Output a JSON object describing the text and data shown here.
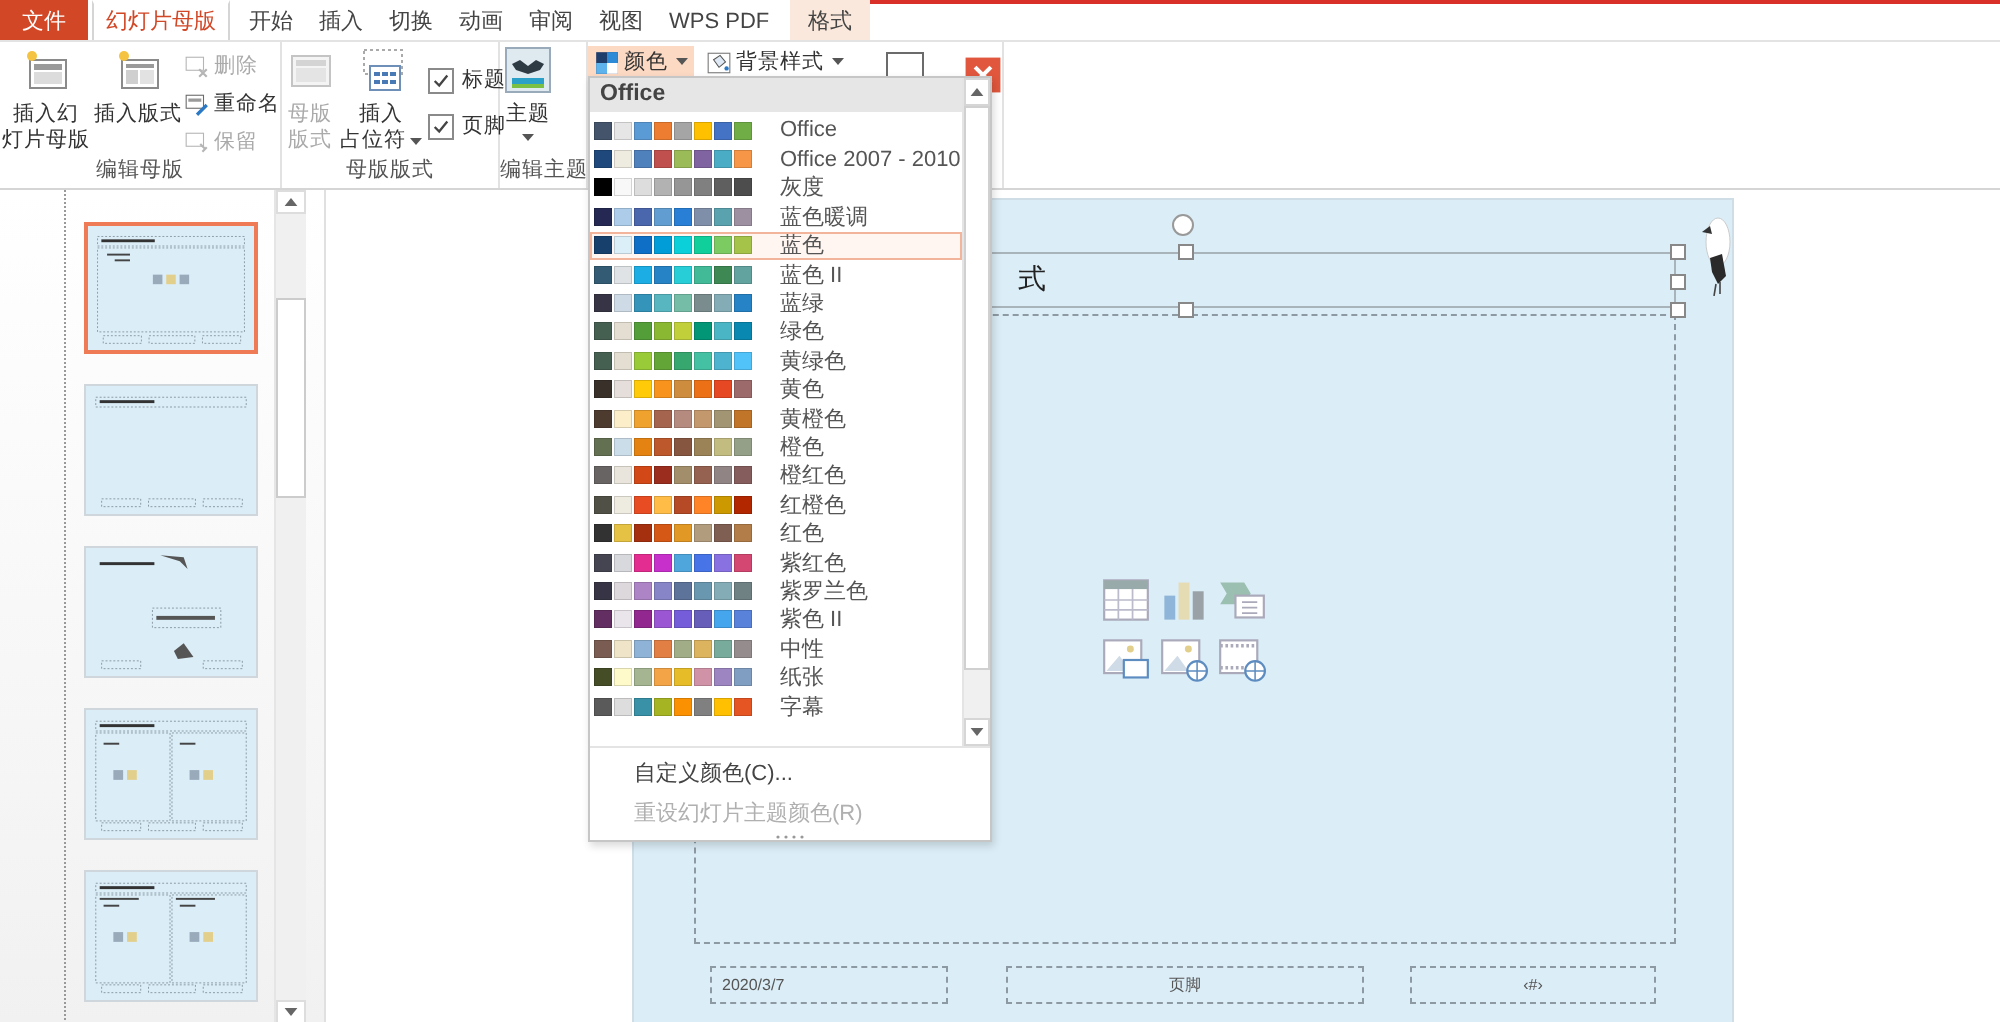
{
  "tabs": [
    {
      "label": "文件",
      "kind": "file",
      "selected": false
    },
    {
      "label": "幻灯片母版",
      "kind": "normal",
      "selected": true
    },
    {
      "label": "开始",
      "kind": "normal",
      "selected": false
    },
    {
      "label": "插入",
      "kind": "normal",
      "selected": false
    },
    {
      "label": "切换",
      "kind": "normal",
      "selected": false
    },
    {
      "label": "动画",
      "kind": "normal",
      "selected": false
    },
    {
      "label": "审阅",
      "kind": "normal",
      "selected": false
    },
    {
      "label": "视图",
      "kind": "normal",
      "selected": false
    },
    {
      "label": "WPS PDF",
      "kind": "normal",
      "selected": false
    },
    {
      "label": "格式",
      "kind": "contextual",
      "selected": false
    }
  ],
  "ribbon": {
    "groups": [
      {
        "label": "编辑母版",
        "controls": [
          {
            "kind": "large",
            "lines": [
              "插入幻",
              "灯片母版"
            ],
            "disabled": false,
            "dropdown": false
          },
          {
            "kind": "large",
            "lines": [
              "插入版式"
            ],
            "disabled": false,
            "dropdown": false
          },
          {
            "kind": "small",
            "label": "删除",
            "disabled": true
          },
          {
            "kind": "small",
            "label": "重命名",
            "disabled": false
          },
          {
            "kind": "small",
            "label": "保留",
            "disabled": true
          }
        ]
      },
      {
        "label": "母版版式",
        "controls": [
          {
            "kind": "large",
            "lines": [
              "母版",
              "版式"
            ],
            "disabled": true,
            "dropdown": false
          },
          {
            "kind": "large",
            "lines": [
              "插入",
              "占位符"
            ],
            "disabled": false,
            "dropdown": true
          },
          {
            "kind": "check",
            "label": "标题",
            "checked": true
          },
          {
            "kind": "check",
            "label": "页脚",
            "checked": true
          }
        ]
      },
      {
        "label": "编辑主题",
        "controls": [
          {
            "kind": "large",
            "lines": [
              "主题"
            ],
            "disabled": false,
            "dropdown": true
          }
        ]
      },
      {
        "controls": [
          {
            "kind": "menu",
            "label": "颜色",
            "active": true,
            "dropdown": true
          },
          {
            "kind": "menu",
            "label": "背景样式",
            "active": false,
            "dropdown": true
          },
          {
            "kind": "icon"
          },
          {
            "kind": "close"
          }
        ]
      }
    ]
  },
  "thumbnails": [
    {
      "kind": "title-content",
      "selected": true
    },
    {
      "kind": "title-only",
      "selected": false
    },
    {
      "kind": "section",
      "selected": false
    },
    {
      "kind": "two-content",
      "selected": false
    },
    {
      "kind": "comparison",
      "selected": false
    }
  ],
  "slide": {
    "title": "式",
    "footer_date": "2020/3/7",
    "footer_text": "页脚",
    "footer_number": "‹#›"
  },
  "color_menu": {
    "header": "Office",
    "schemes": [
      {
        "name": "Office",
        "selected": false,
        "swatches": [
          {
            "color": "#44546a"
          },
          {
            "color": "#e7e6e6"
          },
          {
            "color": "#5b9bd5"
          },
          {
            "color": "#ed7d31"
          },
          {
            "color": "#a5a5a5"
          },
          {
            "color": "#ffc000"
          },
          {
            "color": "#4472c4"
          },
          {
            "color": "#70ad47"
          }
        ]
      },
      {
        "name": "Office 2007 - 2010",
        "selected": false,
        "swatches": [
          {
            "color": "#1f497d"
          },
          {
            "color": "#eeece1"
          },
          {
            "color": "#4f81bd"
          },
          {
            "color": "#c0504d"
          },
          {
            "color": "#9bbb59"
          },
          {
            "color": "#8064a2"
          },
          {
            "color": "#4bacc6"
          },
          {
            "color": "#f79646"
          }
        ]
      },
      {
        "name": "灰度",
        "selected": false,
        "swatches": [
          {
            "color": "#000000"
          },
          {
            "color": "#f8f8f8"
          },
          {
            "color": "#dddddd"
          },
          {
            "color": "#b2b2b2"
          },
          {
            "color": "#969696"
          },
          {
            "color": "#808080"
          },
          {
            "color": "#5f5f5f"
          },
          {
            "color": "#4d4d4d"
          }
        ]
      },
      {
        "name": "蓝色暖调",
        "selected": false,
        "swatches": [
          {
            "color": "#242852"
          },
          {
            "color": "#acccea"
          },
          {
            "color": "#4a66ac"
          },
          {
            "color": "#629dd1"
          },
          {
            "color": "#297fd5"
          },
          {
            "color": "#7f8fa9"
          },
          {
            "color": "#5aa2ae"
          },
          {
            "color": "#9d90a0"
          }
        ]
      },
      {
        "name": "蓝色",
        "selected": true,
        "swatches": [
          {
            "color": "#17406d"
          },
          {
            "color": "#dbeff9"
          },
          {
            "color": "#0f6fc6"
          },
          {
            "color": "#009dd9"
          },
          {
            "color": "#0bd0d9"
          },
          {
            "color": "#10cf9b"
          },
          {
            "color": "#7cca62"
          },
          {
            "color": "#a5c249"
          }
        ]
      },
      {
        "name": "蓝色 II",
        "selected": false,
        "swatches": [
          {
            "color": "#335b74"
          },
          {
            "color": "#dfe3e5"
          },
          {
            "color": "#1cade4"
          },
          {
            "color": "#2683c6"
          },
          {
            "color": "#27ced7"
          },
          {
            "color": "#42ba97"
          },
          {
            "color": "#3e8853"
          },
          {
            "color": "#62a39f"
          }
        ]
      },
      {
        "name": "蓝绿",
        "selected": false,
        "swatches": [
          {
            "color": "#373545"
          },
          {
            "color": "#cedbe6"
          },
          {
            "color": "#3494ba"
          },
          {
            "color": "#58b6c0"
          },
          {
            "color": "#75bda7"
          },
          {
            "color": "#7a8c8e"
          },
          {
            "color": "#84acb6"
          },
          {
            "color": "#2683c6"
          }
        ]
      },
      {
        "name": "绿色",
        "selected": false,
        "swatches": [
          {
            "color": "#455f51"
          },
          {
            "color": "#e3ded1"
          },
          {
            "color": "#549e39"
          },
          {
            "color": "#8ab833"
          },
          {
            "color": "#c0cf3a"
          },
          {
            "color": "#029676"
          },
          {
            "color": "#4ab5c4"
          },
          {
            "color": "#0989b1"
          }
        ]
      },
      {
        "name": "黄绿色",
        "selected": false,
        "swatches": [
          {
            "color": "#455f51"
          },
          {
            "color": "#e3ded1"
          },
          {
            "color": "#99cb38"
          },
          {
            "color": "#63a537"
          },
          {
            "color": "#37a76f"
          },
          {
            "color": "#44c1a3"
          },
          {
            "color": "#4eb3cf"
          },
          {
            "color": "#51c3f9"
          }
        ]
      },
      {
        "name": "黄色",
        "selected": false,
        "swatches": [
          {
            "color": "#39302a"
          },
          {
            "color": "#e5dedb"
          },
          {
            "color": "#ffca08"
          },
          {
            "color": "#f8931d"
          },
          {
            "color": "#ce8d3e"
          },
          {
            "color": "#ec7016"
          },
          {
            "color": "#e64823"
          },
          {
            "color": "#9c6a6a"
          }
        ]
      },
      {
        "name": "黄橙色",
        "selected": false,
        "swatches": [
          {
            "color": "#4e3b30"
          },
          {
            "color": "#fbeec9"
          },
          {
            "color": "#f0a22e"
          },
          {
            "color": "#a5644e"
          },
          {
            "color": "#b58b80"
          },
          {
            "color": "#c3986d"
          },
          {
            "color": "#a19574"
          },
          {
            "color": "#c17529"
          }
        ]
      },
      {
        "name": "橙色",
        "selected": false,
        "swatches": [
          {
            "color": "#637052"
          },
          {
            "color": "#ccddea"
          },
          {
            "color": "#e48312"
          },
          {
            "color": "#bd582c"
          },
          {
            "color": "#865640"
          },
          {
            "color": "#9b8357"
          },
          {
            "color": "#c2bc80"
          },
          {
            "color": "#94a088"
          }
        ]
      },
      {
        "name": "橙红色",
        "selected": false,
        "swatches": [
          {
            "color": "#696464"
          },
          {
            "color": "#e9e5dc"
          },
          {
            "color": "#d34817"
          },
          {
            "color": "#9b2d1f"
          },
          {
            "color": "#a28e6a"
          },
          {
            "color": "#956251"
          },
          {
            "color": "#918485"
          },
          {
            "color": "#855d5d"
          }
        ]
      },
      {
        "name": "红橙色",
        "selected": false,
        "swatches": [
          {
            "color": "#505046"
          },
          {
            "color": "#eeece1"
          },
          {
            "color": "#e84c22"
          },
          {
            "color": "#ffbd47"
          },
          {
            "color": "#b64926"
          },
          {
            "color": "#ff8427"
          },
          {
            "color": "#cc9900"
          },
          {
            "color": "#b22600"
          }
        ]
      },
      {
        "name": "红色",
        "selected": false,
        "swatches": [
          {
            "color": "#323232"
          },
          {
            "color": "#e5c243"
          },
          {
            "color": "#a5300f"
          },
          {
            "color": "#d55816"
          },
          {
            "color": "#e19825"
          },
          {
            "color": "#b19c7d"
          },
          {
            "color": "#7f5f52"
          },
          {
            "color": "#b27d49"
          }
        ]
      },
      {
        "name": "紫红色",
        "selected": false,
        "swatches": [
          {
            "color": "#454551"
          },
          {
            "color": "#d8d9dc"
          },
          {
            "color": "#e32d91"
          },
          {
            "color": "#c830cc"
          },
          {
            "color": "#4ea6dc"
          },
          {
            "color": "#4775e7"
          },
          {
            "color": "#8971e1"
          },
          {
            "color": "#d54773"
          }
        ]
      },
      {
        "name": "紫罗兰色",
        "selected": false,
        "swatches": [
          {
            "color": "#373545"
          },
          {
            "color": "#dcd8dc"
          },
          {
            "color": "#ad84c6"
          },
          {
            "color": "#8784c7"
          },
          {
            "color": "#5d739a"
          },
          {
            "color": "#6997af"
          },
          {
            "color": "#84acb6"
          },
          {
            "color": "#6f8183"
          }
        ]
      },
      {
        "name": "紫色 II",
        "selected": false,
        "swatches": [
          {
            "color": "#632e62"
          },
          {
            "color": "#eae5eb"
          },
          {
            "color": "#92278f"
          },
          {
            "color": "#9b57d3"
          },
          {
            "color": "#755dd9"
          },
          {
            "color": "#665eb8"
          },
          {
            "color": "#45a5ed"
          },
          {
            "color": "#5982db"
          }
        ]
      },
      {
        "name": "中性",
        "selected": false,
        "swatches": [
          {
            "color": "#7a5c52"
          },
          {
            "color": "#efe4c8"
          },
          {
            "color": "#8eb3d6"
          },
          {
            "color": "#e27f45"
          },
          {
            "color": "#a1ad87"
          },
          {
            "color": "#dcb35f"
          },
          {
            "color": "#78ab9b"
          },
          {
            "color": "#958d8d"
          }
        ]
      },
      {
        "name": "纸张",
        "selected": false,
        "swatches": [
          {
            "color": "#444d26"
          },
          {
            "color": "#fefac9"
          },
          {
            "color": "#a5b592"
          },
          {
            "color": "#f3a447"
          },
          {
            "color": "#e7bc29"
          },
          {
            "color": "#d092a7"
          },
          {
            "color": "#9c85c0"
          },
          {
            "color": "#809ec2"
          }
        ]
      },
      {
        "name": "字幕",
        "selected": false,
        "swatches": [
          {
            "color": "#5a5a5a"
          },
          {
            "color": "#dddddd"
          },
          {
            "color": "#3891a7"
          },
          {
            "color": "#a5b423"
          },
          {
            "color": "#fb9000"
          },
          {
            "color": "#808080"
          },
          {
            "color": "#fec000"
          },
          {
            "color": "#e55423"
          }
        ]
      }
    ],
    "custom": "自定义颜色(C)...",
    "reset": {
      "label": "重设幻灯片主题颜色(R)",
      "disabled": true
    }
  }
}
